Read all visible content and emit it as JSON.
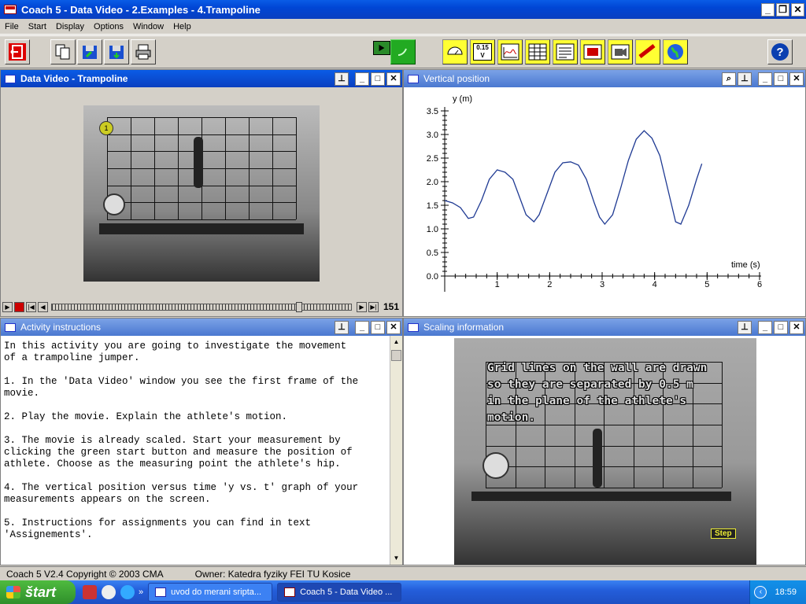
{
  "window": {
    "title": "Coach 5 - Data Video - 2.Examples - 4.Trampoline"
  },
  "menu": [
    "File",
    "Start",
    "Display",
    "Options",
    "Window",
    "Help"
  ],
  "toolbar": {
    "icons": [
      "exit-icon",
      "copy-icon",
      "open-icon",
      "save-icon",
      "print-icon",
      "timer-icon",
      "start-icon",
      "gauge-icon",
      "value-icon",
      "graph-icon",
      "table-icon",
      "text-icon",
      "video-icon",
      "movie-icon",
      "label-icon",
      "globe-icon",
      "help-icon"
    ],
    "value_label": "0.15"
  },
  "video_panel": {
    "title": "Data Video - Trampoline",
    "frame_number": "151",
    "marker_label": "1"
  },
  "graph_panel": {
    "title": "Vertical position"
  },
  "chart_data": {
    "type": "line",
    "title": "",
    "xlabel": "time (s)",
    "ylabel": "y (m)",
    "xlim": [
      0,
      6
    ],
    "ylim": [
      0,
      3.5
    ],
    "x_ticks": [
      "1",
      "2",
      "3",
      "4",
      "5",
      "6"
    ],
    "y_ticks": [
      "0.0",
      "0.5",
      "1.0",
      "1.5",
      "2.0",
      "2.5",
      "3.0",
      "3.5"
    ],
    "grid": false,
    "series": [
      {
        "color": "#1f3a93",
        "x": [
          0,
          0.15,
          0.3,
          0.45,
          0.55,
          0.7,
          0.85,
          1.0,
          1.15,
          1.3,
          1.45,
          1.55,
          1.7,
          1.8,
          1.95,
          2.1,
          2.25,
          2.4,
          2.55,
          2.7,
          2.85,
          2.95,
          3.05,
          3.2,
          3.35,
          3.5,
          3.65,
          3.8,
          3.95,
          4.1,
          4.25,
          4.4,
          4.5,
          4.65,
          4.8,
          4.9
        ],
        "y": [
          1.6,
          1.55,
          1.45,
          1.22,
          1.25,
          1.6,
          2.05,
          2.25,
          2.2,
          2.05,
          1.6,
          1.3,
          1.15,
          1.3,
          1.75,
          2.2,
          2.4,
          2.42,
          2.35,
          2.05,
          1.55,
          1.25,
          1.1,
          1.3,
          1.85,
          2.45,
          2.9,
          3.08,
          2.92,
          2.55,
          1.85,
          1.15,
          1.1,
          1.5,
          2.05,
          2.38
        ]
      }
    ]
  },
  "instructions_panel": {
    "title": "Activity instructions",
    "text": "In this activity you are going to investigate the movement\nof a trampoline jumper.\n\n1. In the 'Data Video' window you see the first frame of the\nmovie.\n\n2. Play the movie. Explain the athlete's motion.\n\n3. The movie is already scaled. Start your measurement by\nclicking the green start button and measure the position of\nathlete. Choose as the measuring point the athlete's hip.\n\n4. The vertical position versus time 'y vs. t' graph of your\nmeasurements appears on the screen.\n\n5. Instructions for assignments you can find in text\n'Assignements'."
  },
  "scaling_panel": {
    "title": "Scaling information",
    "overlay_text": "Grid lines on the wall are drawn\nso they are separated by 0.5 m\nin the plane of the athlete's\nmotion.",
    "step_label": "Step"
  },
  "status": {
    "copyright": "Coach 5 V2.4 Copyright © 2003 CMA",
    "owner": "Owner: Katedra fyziky FEI TU Kosice"
  },
  "taskbar": {
    "start_label": "štart",
    "tasks": [
      "uvod do merani sripta...",
      "Coach 5 - Data Video ..."
    ],
    "clock": "18:59"
  }
}
